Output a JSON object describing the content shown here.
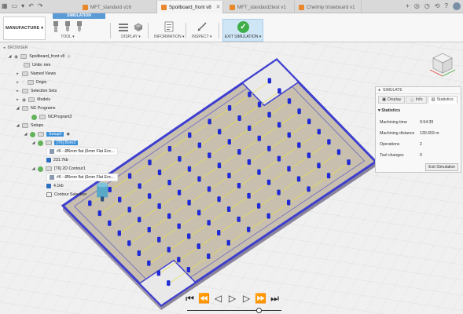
{
  "tabs": [
    {
      "label": "MFT_standard v16"
    },
    {
      "label": "Spoilboard_front v8"
    },
    {
      "label": "MFT_standard2test v1"
    },
    {
      "label": "Chelmly tristeboard v1"
    }
  ],
  "ribbon": {
    "workspace": "MANUFACTURE",
    "section_label": "SIMULATION",
    "groups": {
      "tool": "TOOL",
      "display": "DISPLAY",
      "information": "INFORMATION",
      "inspect": "INSPECT",
      "exit": "EXIT SIMULATION"
    }
  },
  "browser": {
    "title": "BROWSER",
    "root": "Spoilboard_front v8",
    "units": "Units: mm",
    "named_views": "Named Views",
    "origin": "Origin",
    "selection_sets": "Selection Sets",
    "models": "Models",
    "nc_programs": "NC Programs",
    "nc_program": "NCProgram3",
    "setups": "Setups",
    "setup": "Setup3",
    "op1": "[T6] Bore3",
    "op1_tool": "#6 - Ø6mm flat (6mm Flat Enc...",
    "op1_size": "231.7kb",
    "op2": "[T6] 2D Contour1",
    "op2_tool": "#6 - Ø6mm flat (6mm Flat Enc...",
    "op2_size": "4.1kb",
    "op2_geom": "Contour Selection"
  },
  "simulate": {
    "title": "SIMULATE",
    "tabs": [
      "Display",
      "Info",
      "Statistics"
    ],
    "section": "Statistics",
    "rows": [
      {
        "label": "Machining time",
        "value": "0:54:39"
      },
      {
        "label": "Machining distance",
        "value": "130.659 m"
      },
      {
        "label": "Operations",
        "value": "2"
      },
      {
        "label": "Tool changes",
        "value": "0"
      }
    ],
    "exit_button": "Exit Simulation"
  },
  "playback": {
    "buttons": [
      "skip-start",
      "step-back-op",
      "step-back",
      "play",
      "step-forward",
      "step-forward-op",
      "skip-end"
    ],
    "progress": 0.77
  },
  "colors": {
    "stock": "#c8bfae",
    "border_blue": "#3e3fcf",
    "hole_blue": "#1f2ad6",
    "toolpath_yellow": "#e8e04a",
    "tool_teal": "#5aa8c8",
    "accent": "#3a8fd9"
  }
}
